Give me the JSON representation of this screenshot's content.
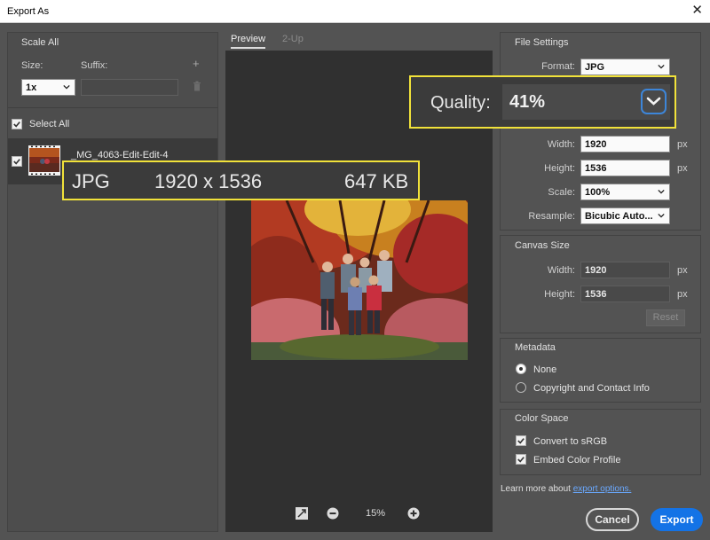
{
  "window": {
    "title": "Export As",
    "close_symbol": "✕"
  },
  "left": {
    "scale_all": "Scale All",
    "size_label": "Size:",
    "suffix_label": "Suffix:",
    "size_value": "1x",
    "suffix_value": "",
    "add_symbol": "+",
    "select_all": "Select All",
    "file_name": "_MG_4063-Edit-Edit-4"
  },
  "tabs": {
    "preview": "Preview",
    "two_up": "2-Up"
  },
  "file_callout": {
    "format": "JPG",
    "dimensions": "1920 x 1536",
    "size": "647 KB"
  },
  "zoom": {
    "level": "15%"
  },
  "right": {
    "file_settings": "File Settings",
    "format_label": "Format:",
    "format_value": "JPG",
    "quality_label": "Quality:",
    "quality_value": "41%",
    "width_label": "Width:",
    "width_value": "1920",
    "height_label": "Height:",
    "height_value": "1536",
    "unit_px": "px",
    "scale_label": "Scale:",
    "scale_value": "100%",
    "resample_label": "Resample:",
    "resample_value": "Bicubic Auto...",
    "canvas_size": "Canvas Size",
    "canvas_width_label": "Width:",
    "canvas_width_value": "1920",
    "canvas_height_label": "Height:",
    "canvas_height_value": "1536",
    "reset": "Reset",
    "metadata": "Metadata",
    "meta_none": "None",
    "meta_copyright": "Copyright and Contact Info",
    "color_space": "Color Space",
    "convert_srgb": "Convert to sRGB",
    "embed_profile": "Embed Color Profile",
    "learn_more": "Learn more about",
    "export_options": "export options."
  },
  "buttons": {
    "cancel": "Cancel",
    "export": "Export"
  },
  "colors": {
    "accent": "#1473e6",
    "highlight": "#f1e23a",
    "panel": "#535353",
    "preview_bg": "#303030"
  }
}
